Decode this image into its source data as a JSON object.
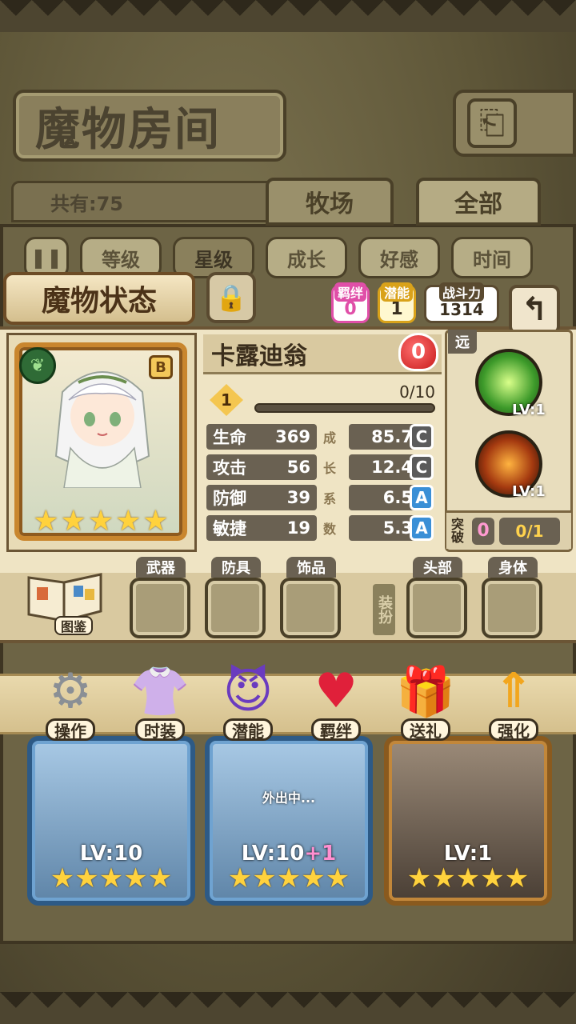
{
  "header": {
    "title": "魔物房间",
    "back_icon": "return-icon"
  },
  "filter": {
    "count_label": "共有:75",
    "tabs": [
      {
        "label": "牧场"
      },
      {
        "label": "全部"
      }
    ]
  },
  "sort": {
    "buttons": [
      {
        "label": "等级"
      },
      {
        "label": "星级"
      },
      {
        "label": "成长"
      },
      {
        "label": "好感"
      },
      {
        "label": "时间"
      }
    ],
    "selected": "星级"
  },
  "status": {
    "title": "魔物状态",
    "bond": {
      "label": "羁绊",
      "value": "0"
    },
    "potential": {
      "label": "潜能",
      "value": "1"
    },
    "power": {
      "label": "战斗力",
      "value": "1314"
    }
  },
  "monster": {
    "name": "卡露迪翁",
    "grade": "B",
    "affection": "0",
    "level": "1",
    "exp": "0/10",
    "stars": 5,
    "stats": [
      {
        "label": "生命",
        "value": "369",
        "growth": "85.7",
        "rank": "C"
      },
      {
        "label": "攻击",
        "value": "56",
        "growth": "12.4",
        "rank": "C"
      },
      {
        "label": "防御",
        "value": "39",
        "growth": "6.5",
        "rank": "A"
      },
      {
        "label": "敏捷",
        "value": "19",
        "growth": "5.3",
        "rank": "A"
      }
    ],
    "growth_chars": [
      "成",
      "长",
      "系",
      "数"
    ]
  },
  "skills": {
    "range": "远",
    "items": [
      {
        "level": "LV:1"
      },
      {
        "level": "LV:1"
      }
    ],
    "breakthrough_label": "突破",
    "breakthrough_value": "0",
    "breakthrough_count": "0/1"
  },
  "equipment": {
    "book_label": "图鉴",
    "dress_label": "装扮",
    "slots": [
      {
        "label": "武器"
      },
      {
        "label": "防具"
      },
      {
        "label": "饰品"
      },
      {
        "label": "头部"
      },
      {
        "label": "身体"
      }
    ]
  },
  "menu": [
    {
      "label": "操作",
      "icon": "gear-icon"
    },
    {
      "label": "时装",
      "icon": "outfit-icon"
    },
    {
      "label": "潜能",
      "icon": "demon-icon"
    },
    {
      "label": "羁绊",
      "icon": "hearts-icon"
    },
    {
      "label": "送礼",
      "icon": "gift-icon"
    },
    {
      "label": "强化",
      "icon": "upgrade-arrows-icon"
    }
  ],
  "cards": [
    {
      "level": "LV:10",
      "plus": "",
      "status": "",
      "stars": 5
    },
    {
      "level": "LV:10",
      "plus": "+1",
      "status": "外出中...",
      "stars": 5
    },
    {
      "level": "LV:1",
      "plus": "",
      "status": "",
      "stars": 5
    }
  ],
  "colors": {
    "accent": "#c9862e",
    "panel": "#efe4c4",
    "stat_bg": "#6a6152",
    "rank_c": "#5b5b5b",
    "rank_a": "#3a8fd6"
  }
}
